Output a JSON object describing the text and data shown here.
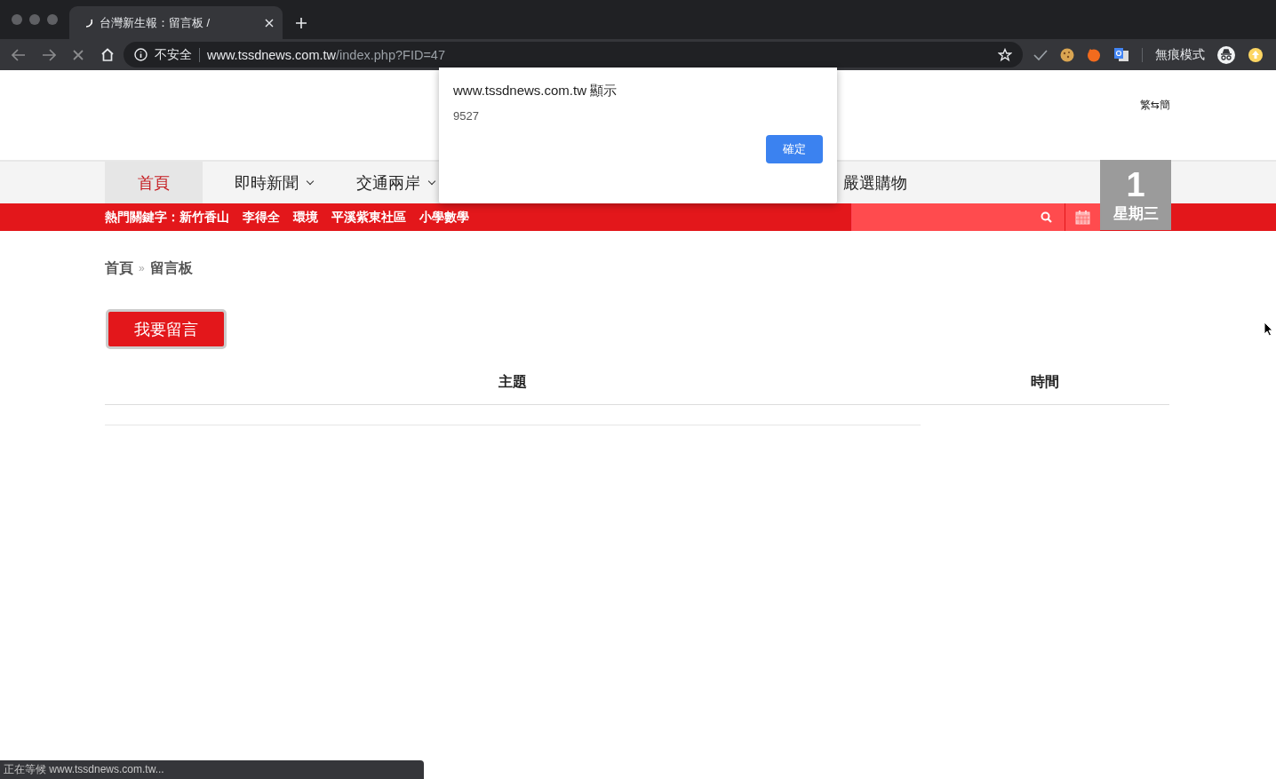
{
  "browser": {
    "tab": {
      "title": "台灣新生報：留言板 /",
      "loading": true
    },
    "address": {
      "security": "不安全",
      "host": "www.tssdnews.com.tw",
      "path": "/index.php?FID=47"
    },
    "profile_label": "無痕模式"
  },
  "page": {
    "lang_switch": "繁⇆簡",
    "nav": [
      {
        "label": "首頁",
        "selected": true,
        "dropdown": false
      },
      {
        "label": "即時新聞",
        "selected": false,
        "dropdown": true
      },
      {
        "label": "交通兩岸",
        "selected": false,
        "dropdown": true
      },
      {
        "label": "嚴選購物",
        "selected": false,
        "dropdown": false
      }
    ],
    "hot_keywords": {
      "label": "熱門關鍵字：",
      "items": [
        "新竹香山",
        "李得全",
        "環境",
        "平溪紫東社區",
        "小學數學"
      ]
    },
    "date": {
      "day": "1",
      "weekday": "星期三"
    },
    "breadcrumb": {
      "items": [
        "首頁",
        "留言板"
      ],
      "separator": "»"
    },
    "post_button": "我要留言",
    "table": {
      "columns": [
        "主題",
        "時間"
      ]
    }
  },
  "dialog": {
    "title": "www.tssdnews.com.tw 顯示",
    "message": "9527",
    "button": "確定"
  },
  "status_bar": "正在等候 www.tssdnews.com.tw..."
}
